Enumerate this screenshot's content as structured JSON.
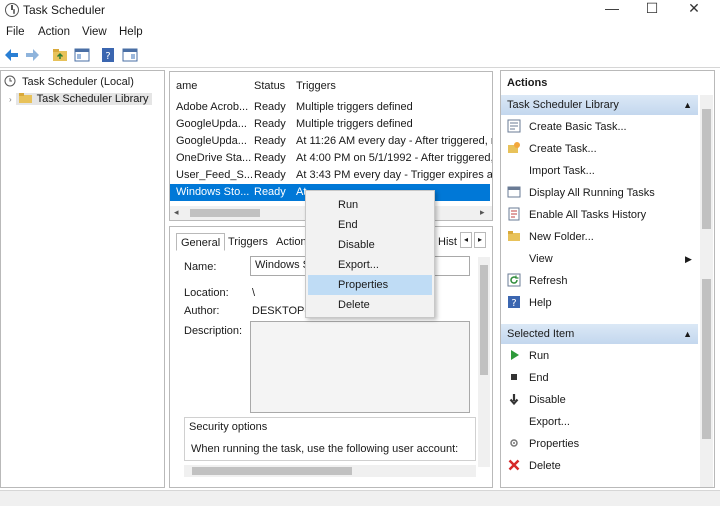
{
  "window": {
    "title": "Task Scheduler",
    "minimize": "—",
    "maximize": "☐",
    "close": "✕"
  },
  "menu": [
    "File",
    "Action",
    "View",
    "Help"
  ],
  "tree": {
    "root": "Task Scheduler (Local)",
    "library": "Task Scheduler Library"
  },
  "task_list": {
    "columns": {
      "name": "ame",
      "status": "Status",
      "triggers": "Triggers"
    },
    "rows": [
      {
        "name": "Adobe Acrob...",
        "status": "Ready",
        "triggers": "Multiple triggers defined"
      },
      {
        "name": "GoogleUpda...",
        "status": "Ready",
        "triggers": "Multiple triggers defined"
      },
      {
        "name": "GoogleUpda...",
        "status": "Ready",
        "triggers": "At 11:26 AM every day - After triggered, re"
      },
      {
        "name": "OneDrive Sta...",
        "status": "Ready",
        "triggers": "At 4:00 PM on 5/1/1992 - After triggered, r"
      },
      {
        "name": "User_Feed_S...",
        "status": "Ready",
        "triggers": "At 3:43 PM every day - Trigger expires at 3"
      },
      {
        "name": "Windows Sto...",
        "status": "Ready",
        "triggers": "At"
      }
    ]
  },
  "detail": {
    "tabs": [
      "General",
      "Triggers",
      "Actions",
      "Hist"
    ],
    "name_label": "Name:",
    "name_value": "Windows S",
    "location_label": "Location:",
    "location_value": "\\",
    "author_label": "Author:",
    "author_value": "DESKTOP-",
    "description_label": "Description:",
    "security_title": "Security options",
    "security_text": "When running the task, use the following user account:"
  },
  "context_menu": [
    "Run",
    "End",
    "Disable",
    "Export...",
    "Properties",
    "Delete"
  ],
  "actions": {
    "header": "Actions",
    "library_section": "Task Scheduler Library",
    "library_items": [
      {
        "label": "Create Basic Task...",
        "icon": "create-basic-task-icon"
      },
      {
        "label": "Create Task...",
        "icon": "create-task-icon"
      },
      {
        "label": "Import Task...",
        "icon": "import-task-icon"
      },
      {
        "label": "Display All Running Tasks",
        "icon": "running-tasks-icon"
      },
      {
        "label": "Enable All Tasks History",
        "icon": "history-icon"
      },
      {
        "label": "New Folder...",
        "icon": "folder-icon"
      },
      {
        "label": "View",
        "icon": "view-icon"
      },
      {
        "label": "Refresh",
        "icon": "refresh-icon"
      },
      {
        "label": "Help",
        "icon": "help-icon"
      }
    ],
    "selected_section": "Selected Item",
    "selected_items": [
      {
        "label": "Run",
        "icon": "run-icon"
      },
      {
        "label": "End",
        "icon": "end-icon"
      },
      {
        "label": "Disable",
        "icon": "disable-icon"
      },
      {
        "label": "Export...",
        "icon": "export-icon"
      },
      {
        "label": "Properties",
        "icon": "properties-icon"
      },
      {
        "label": "Delete",
        "icon": "delete-icon"
      }
    ]
  },
  "colors": {
    "selection": "#0078d7",
    "section_header": "#c3d7ee",
    "menu_hover": "#bfdcf5"
  }
}
